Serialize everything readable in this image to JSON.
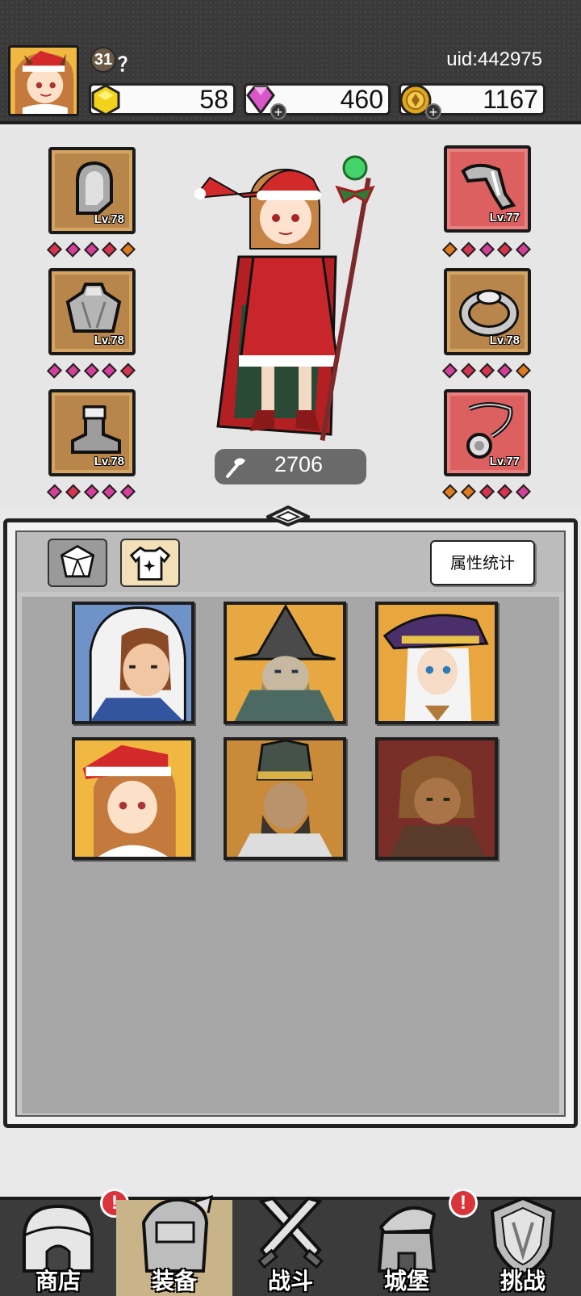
{
  "player": {
    "level": "31",
    "name": "？",
    "uid": "uid:442975"
  },
  "currencies": [
    {
      "name": "gold-crystal",
      "value": "58",
      "color": "#f2d21b"
    },
    {
      "name": "diamond",
      "value": "460",
      "color": "#d857c8"
    },
    {
      "name": "coin",
      "value": "1167",
      "color": "#e0a51e"
    }
  ],
  "equipment": {
    "left": [
      {
        "item": "hood",
        "level": "Lv.78"
      },
      {
        "item": "cloak",
        "level": "Lv.78"
      },
      {
        "item": "boots",
        "level": "Lv.78"
      }
    ],
    "right": [
      {
        "item": "gauntlet",
        "level": "Lv.77"
      },
      {
        "item": "ring",
        "level": "Lv.78"
      },
      {
        "item": "amulet",
        "level": "Lv.77"
      }
    ]
  },
  "power": "2706",
  "panel": {
    "stat_button": "属性统计",
    "tabs": [
      "gem-icon",
      "shirt-icon"
    ],
    "heroes": [
      "white-hood-knight",
      "grey-wizard",
      "witch",
      "santa-girl",
      "bishop",
      "monkey-king"
    ]
  },
  "nav": [
    {
      "label": "商店",
      "alert": "!"
    },
    {
      "label": "装备",
      "alert": ""
    },
    {
      "label": "战斗",
      "alert": ""
    },
    {
      "label": "城堡",
      "alert": "!"
    },
    {
      "label": "挑战",
      "alert": ""
    }
  ],
  "colors": {
    "gem_pink": "#d43f9a",
    "gem_red": "#d6334e",
    "gem_orange": "#e07a1f",
    "slot_gold": "#b8864a",
    "slot_red": "#dd6060"
  }
}
